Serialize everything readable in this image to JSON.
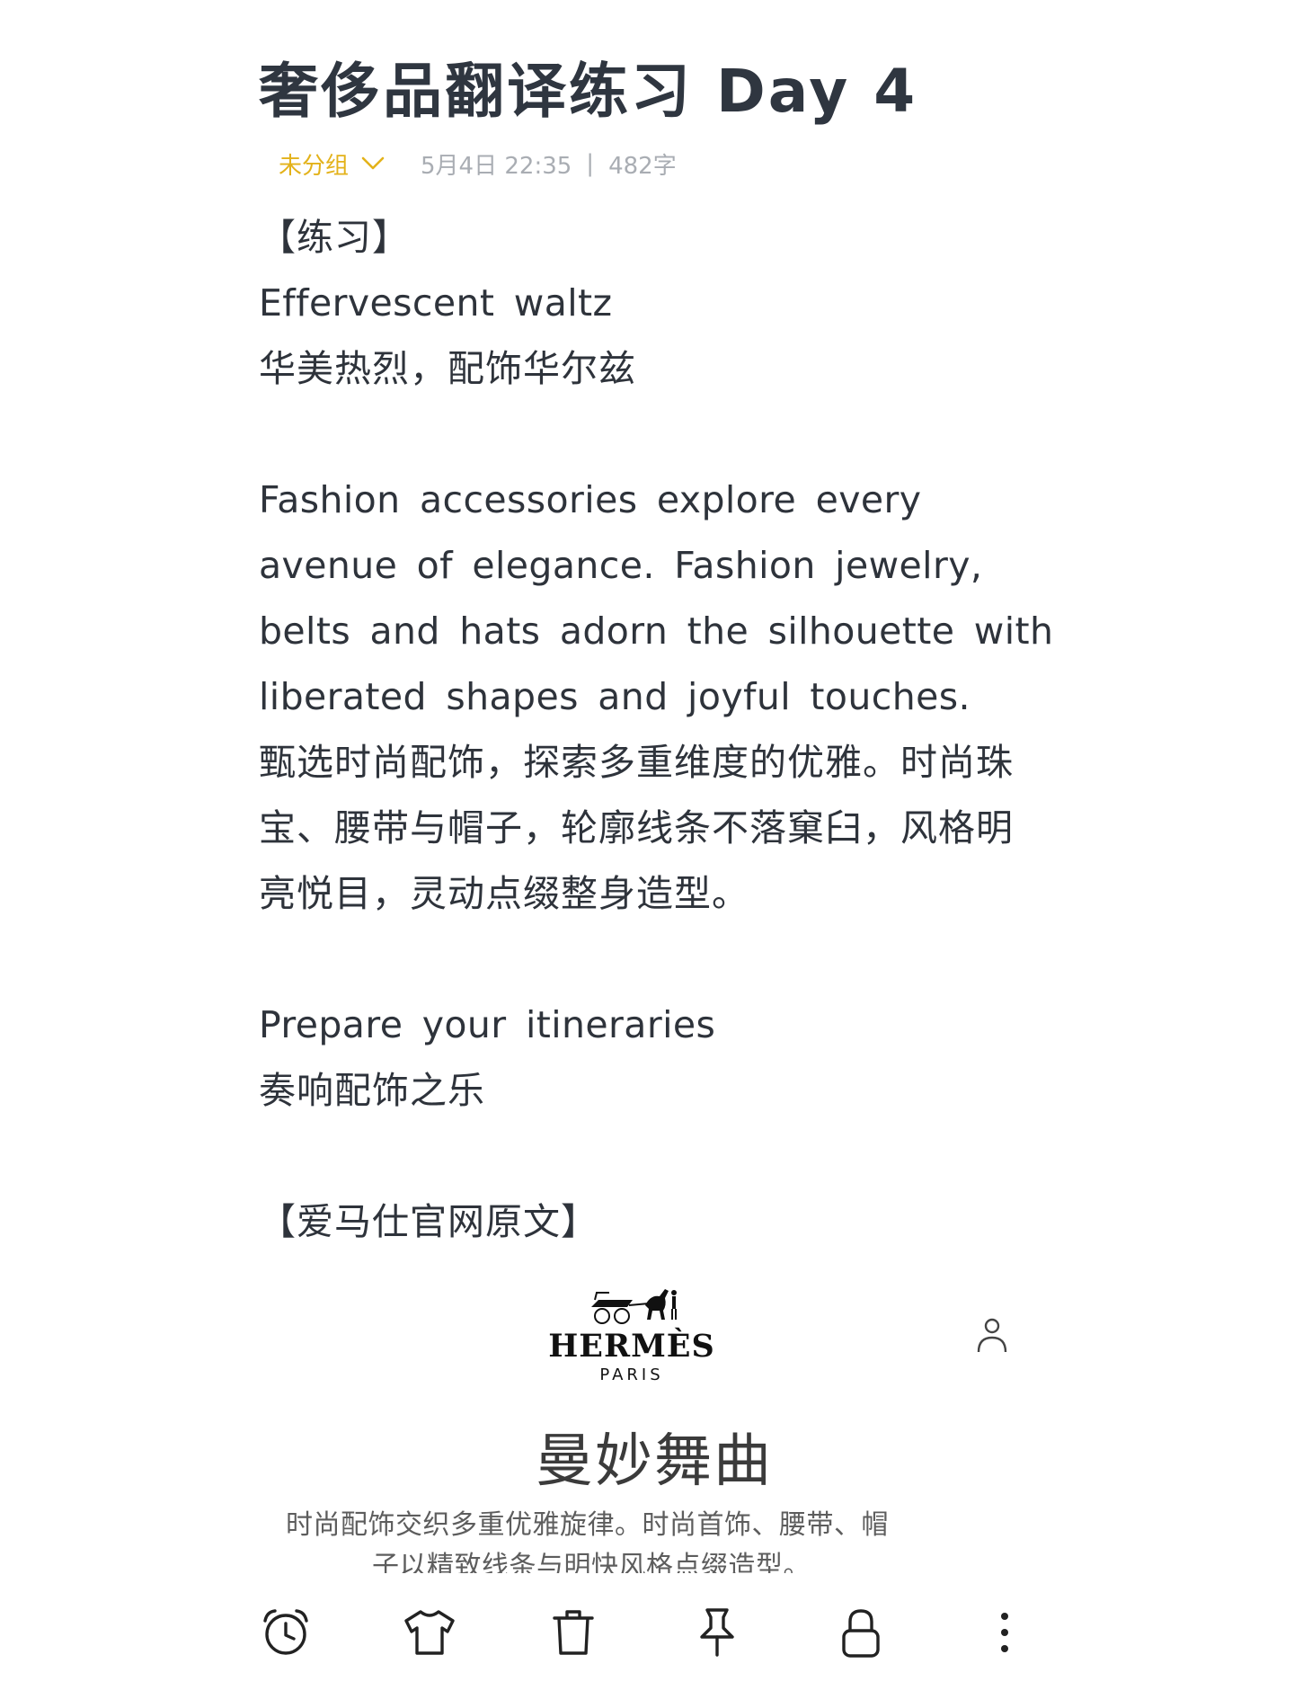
{
  "note": {
    "title": "奢侈品翻译练习 Day 4",
    "group": "未分组",
    "date": "5月4日 22:35",
    "separator": "|",
    "word_count": "482字"
  },
  "content": {
    "lines": [
      "【练习】",
      "Effervescent waltz",
      "华美热烈，配饰华尔兹",
      "",
      "Fashion accessories explore every",
      "avenue of elegance. Fashion jewelry,",
      "belts and hats adorn the silhouette with",
      "liberated shapes and joyful touches.",
      "甄选时尚配饰，探索多重维度的优雅。时尚珠",
      "宝、腰带与帽子，轮廓线条不落窠臼，风格明",
      "亮悦目，灵动点缀整身造型。",
      "",
      "Prepare your itineraries",
      "奏响配饰之乐",
      "",
      "【爱马仕官网原文】"
    ]
  },
  "embedded": {
    "logo_text": "HERMÈS",
    "logo_sub": "PARIS",
    "heading": "曼妙舞曲",
    "body_line1": "时尚配饰交织多重优雅旋律。时尚首饰、腰带、帽",
    "body_line2": "子以精致线条与明快风格点缀造型。"
  },
  "toolbar": {
    "items": [
      "alarm-icon",
      "shirt-icon",
      "trash-icon",
      "pin-icon",
      "lock-icon",
      "more-icon"
    ]
  },
  "colors": {
    "accent": "#e3b21a",
    "text": "#2e333b",
    "meta": "#a9adb3"
  }
}
